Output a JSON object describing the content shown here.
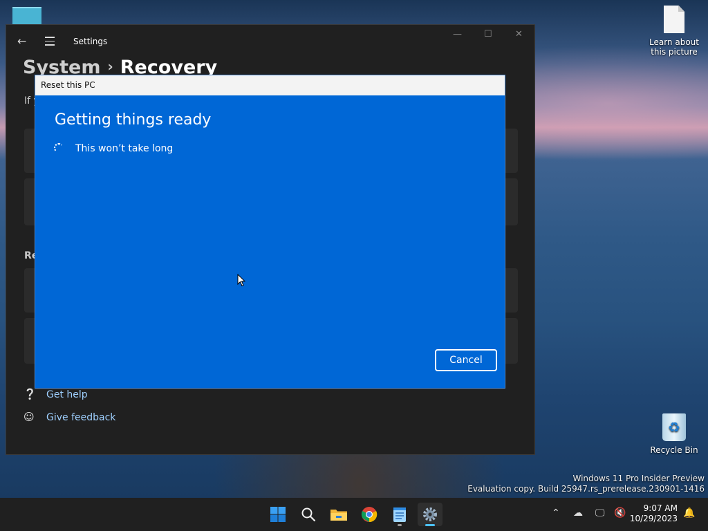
{
  "desktop": {
    "icons": [
      {
        "label": "Learn about this picture"
      },
      {
        "label": "Recycle Bin"
      }
    ],
    "watermark": {
      "line1": "Windows 11 Pro Insider Preview",
      "line2": "Evaluation copy. Build 25947.rs_prerelease.230901-1416"
    }
  },
  "settings": {
    "title": "Settings",
    "breadcrumb": {
      "parent": "System",
      "separator": "›",
      "current": "Recovery"
    },
    "partial_description": "If y",
    "partial_section": "Re",
    "links": {
      "help": "Get help",
      "feedback": "Give feedback"
    },
    "window_controls": {
      "minimize": "—",
      "maximize": "☐",
      "close": "✕"
    }
  },
  "dialog": {
    "title": "Reset this PC",
    "heading": "Getting things ready",
    "status": "This won’t take long",
    "cancel": "Cancel"
  },
  "taskbar": {
    "apps": [
      {
        "name": "start",
        "icon": "windows-logo-icon"
      },
      {
        "name": "search",
        "icon": "search-icon"
      },
      {
        "name": "file-explorer",
        "icon": "folder-icon"
      },
      {
        "name": "chrome",
        "icon": "chrome-icon"
      },
      {
        "name": "notepad",
        "icon": "notepad-icon"
      },
      {
        "name": "settings",
        "icon": "gear-icon",
        "active": true
      }
    ],
    "clock": {
      "time": "9:07 AM",
      "date": "10/29/2023"
    }
  },
  "colors": {
    "dialog_blue": "#0067d6",
    "settings_bg": "#202020",
    "link_blue": "#9fd0ff",
    "taskbar_bg": "#202020",
    "active_indicator": "#4cc2ff"
  }
}
